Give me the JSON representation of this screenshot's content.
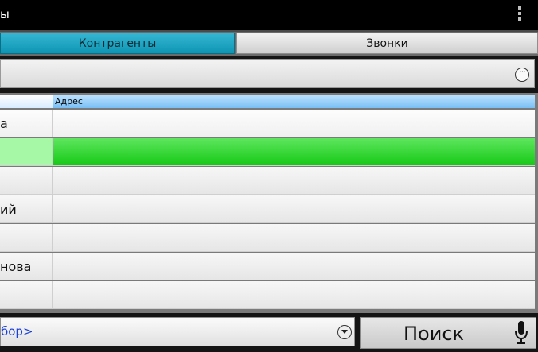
{
  "actionbar": {
    "title": "ы"
  },
  "tabs": [
    {
      "label": "Контрагенты",
      "active": true
    },
    {
      "label": "Звонки",
      "active": false
    }
  ],
  "table": {
    "columns": [
      "",
      "Адрес"
    ],
    "rows": [
      {
        "name": "а",
        "address": ""
      },
      {
        "name": "",
        "address": "",
        "selected": true
      },
      {
        "name": "",
        "address": ""
      },
      {
        "name": "ий",
        "address": ""
      },
      {
        "name": "",
        "address": ""
      },
      {
        "name": "нова",
        "address": ""
      },
      {
        "name": "",
        "address": ""
      }
    ]
  },
  "bottom": {
    "combo_value": "бор>",
    "search_label": "Поиск"
  },
  "colors": {
    "tab_active": "#0e95b3",
    "row_selected": "#16c916",
    "link_text": "#1a3fd8"
  }
}
